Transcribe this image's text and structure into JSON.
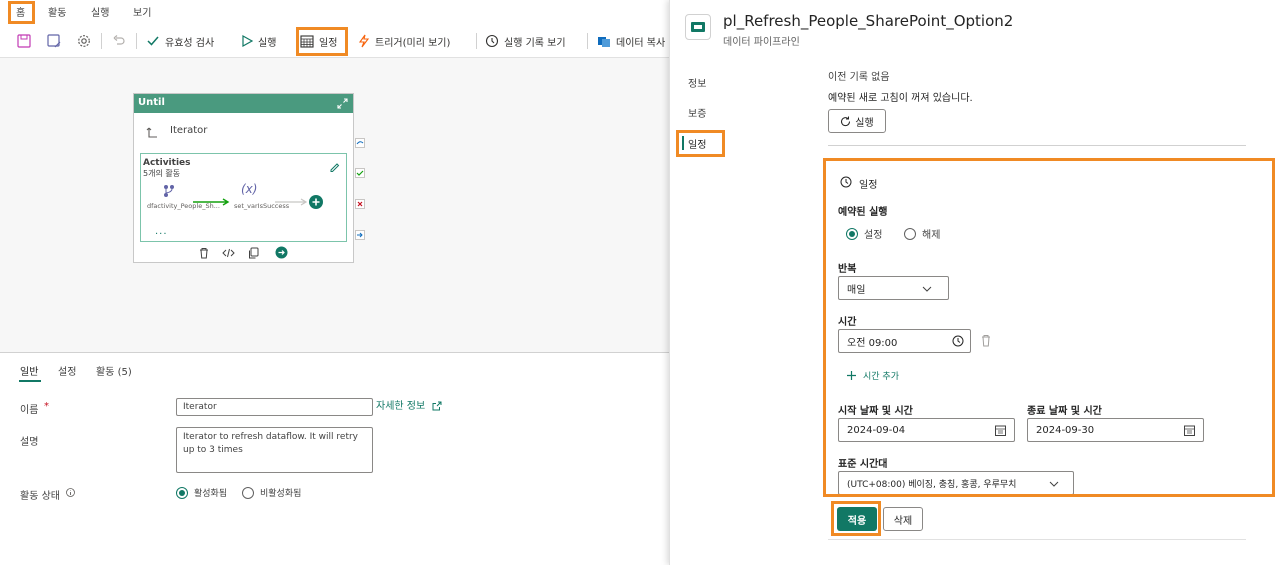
{
  "menu": {
    "home": "홈",
    "activity": "활동",
    "run": "실행",
    "view": "보기"
  },
  "toolbar": {
    "validate": "유효성 검사",
    "run": "실행",
    "schedule": "일정",
    "trigger": "트리거(미리 보기)",
    "run_history": "실행 기록 보기",
    "data": "데이터 복사"
  },
  "canvas": {
    "until_title": "Until",
    "iterator_label": "Iterator",
    "activities_title": "Activities",
    "activities_count": "5개의 활동",
    "node1": "dfactivity_People_Sh...",
    "node2_symbol": "(x)",
    "node2": "set_varIsSuccess",
    "ellipsis": "..."
  },
  "properties": {
    "tabs": [
      "일반",
      "설정",
      "활동 (5)"
    ],
    "name_label": "이름",
    "name_required": "*",
    "name_value": "Iterator",
    "more_info": "자세한 정보",
    "description_label": "설명",
    "description_value": "Iterator to refresh dataflow. It will retry up to 3 times",
    "status_label": "활동 상태",
    "status_active": "활성화됨",
    "status_inactive": "비활성화됨"
  },
  "panel": {
    "title": "pl_Refresh_People_SharePoint_Option2",
    "subtitle": "데이터 파이프라인",
    "nav": [
      "정보",
      "보증",
      "일정"
    ],
    "no_history": "이전 기록 없음",
    "refresh_off": "예약된 새로 고침이 꺼져 있습니다.",
    "run_button": "실행",
    "schedule_header": "일정",
    "scheduled_run_label": "예약된 실행",
    "on": "설정",
    "off": "해제",
    "repeat_label": "반복",
    "repeat_value": "매일",
    "time_label": "시간",
    "time_value": "오전 09:00",
    "add_time": "시간 추가",
    "start_label": "시작 날짜 및 시간",
    "start_value": "2024-09-04",
    "end_label": "종료 날짜 및 시간",
    "end_value": "2024-09-30",
    "timezone_label": "표준 시간대",
    "timezone_value": "(UTC+08:00) 베이징, 충칭, 홍콩, 우루무치",
    "apply": "적용",
    "delete": "삭제"
  },
  "colors": {
    "accent": "#117865",
    "highlight": "#f08a24",
    "until_header": "#4a9a7f"
  }
}
